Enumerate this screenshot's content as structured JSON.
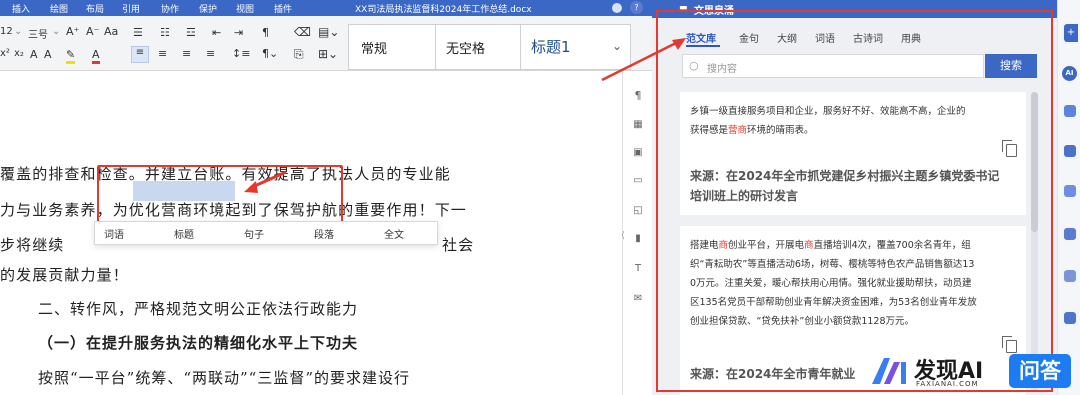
{
  "menu": [
    "插入",
    "绘图",
    "布局",
    "引用",
    "协作",
    "保护",
    "视图",
    "插件"
  ],
  "document_title": "XX司法局执法监督科2024年工作总结.docx",
  "ribbon": {
    "font_size": "12",
    "heading_level": "三号",
    "styles": [
      "常规",
      "无空格",
      "标题1"
    ]
  },
  "doc_lines": [
    "覆盖的排查和检查。并建立台账。有效提高了执法人员的专业能",
    "力与业务素养，为优化营商环境起到了保驾护航的重要作用！下一",
    "步将继续",
    "社会",
    "的发展贡献力量！",
    "二、转作风，严格规范文明公正依法行政能力",
    "（一）在提升服务执法的精细化水平上下功夫",
    "按照“一平台”统筹、“两联动”“三监督”的要求建设行"
  ],
  "selection_popup": [
    "词语",
    "标题",
    "句子",
    "段落",
    "全文"
  ],
  "side_tools": [
    "paragraph-mark-icon",
    "table-icon",
    "image-icon",
    "page-icon",
    "shape-icon",
    "chart-icon",
    "text-art-icon",
    "mail-icon"
  ],
  "panel": {
    "title": "文思泉涌",
    "tabs": [
      "范文库",
      "金句",
      "大纲",
      "词语",
      "古诗词",
      "用典"
    ],
    "active_tab": "范文库",
    "search_placeholder": "搜内容",
    "search_button": "搜索",
    "cards": [
      {
        "text_lines": [
          "乡镇一级直接服务项目和企业，服务好不好、效能高不高，企业的",
          "获得感是营商环境的晴雨表。"
        ],
        "highlight": "营商",
        "source_lines": [
          "来源：在2024年全市抓党建促乡村振兴主题乡镇党委书记",
          "培训班上的研讨发言"
        ]
      },
      {
        "text_lines": [
          "搭建电商创业平台，开展电商直播培训4次，覆盖700余名青年，组",
          "织“青耘助农”等直播活动6场，树莓、樱桃等特色农产品销售额达13",
          "0万元。注重关爱，暖心帮扶用心用情。强化就业援助帮扶，动员建",
          "区135名党员干部帮助创业青年解决资金困难，为53名创业青年发放",
          "创业担保贷款、“贷免扶补”创业小额贷款1128万元。"
        ],
        "highlight": "商",
        "source_lines": [
          "来源：在2024年全市青年就业"
        ]
      }
    ]
  },
  "watermark": {
    "title": "发现AI",
    "subtitle": "FAXIANAI.COM",
    "badge": "问答"
  },
  "colors": {
    "brand_blue": "#3b67c5",
    "annotation_red": "#e23a2f",
    "highlight_red": "#e23a2f"
  }
}
